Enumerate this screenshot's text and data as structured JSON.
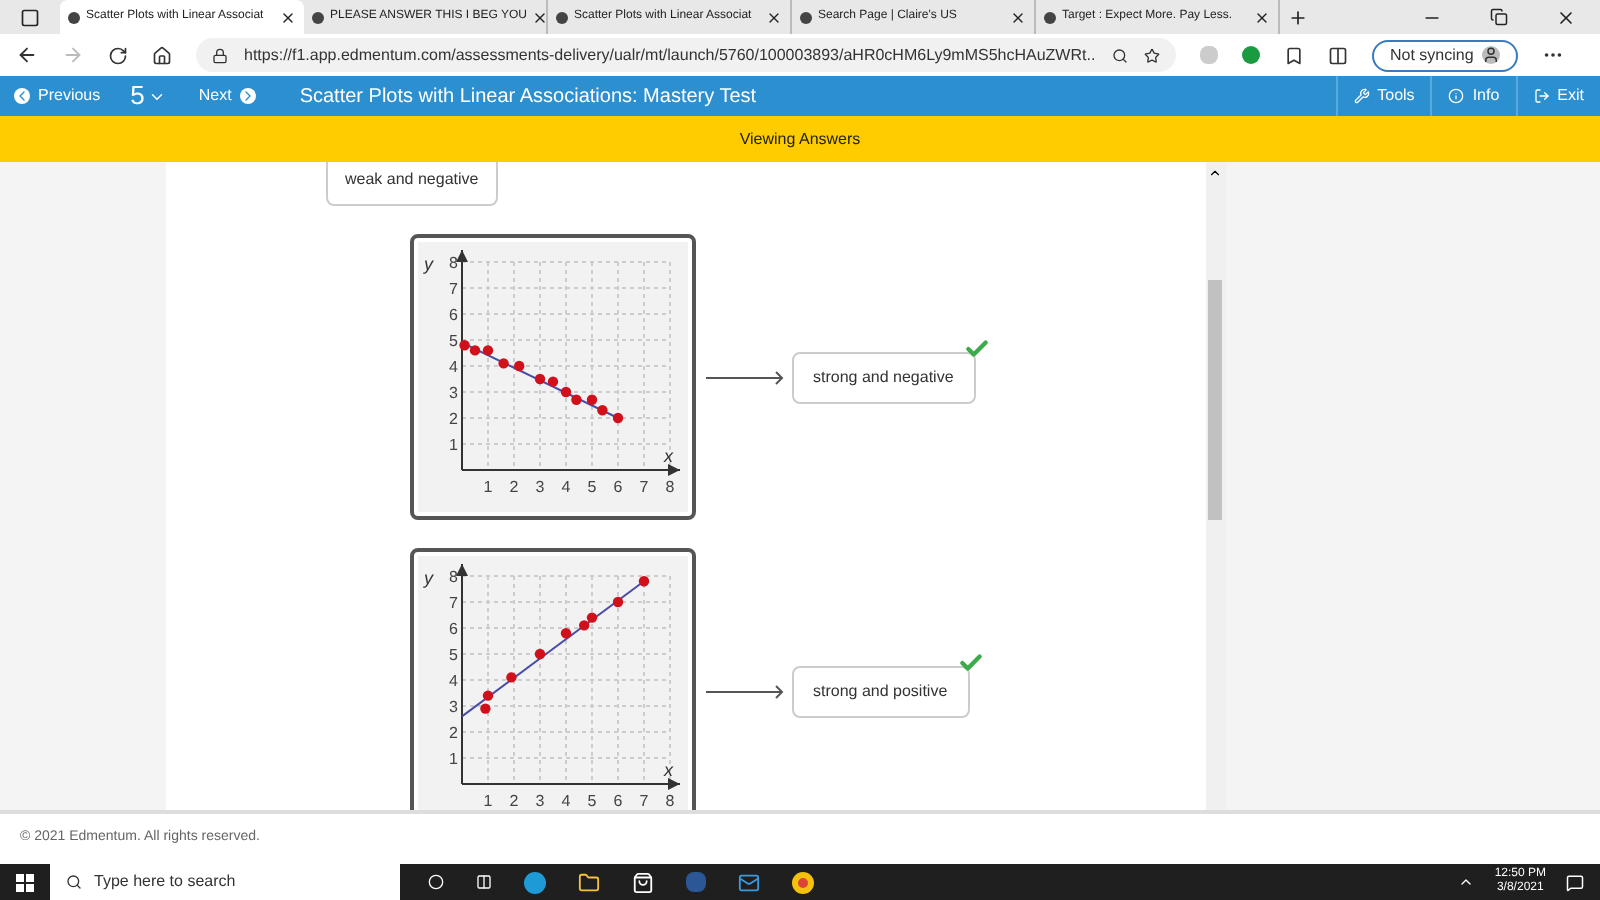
{
  "browser_tabs": [
    {
      "title": "Scatter Plots with Linear Associat",
      "selected": true
    },
    {
      "title": "PLEASE ANSWER THIS I BEG YOU",
      "selected": false
    },
    {
      "title": "Scatter Plots with Linear Associat",
      "selected": false
    },
    {
      "title": "Search Page | Claire's US",
      "selected": false
    },
    {
      "title": "Target : Expect More. Pay Less.",
      "selected": false
    }
  ],
  "address": "https://f1.app.edmentum.com/assessments-delivery/ualr/mt/launch/5760/100003893/aHR0cHM6Ly9mMS5hcHAuZWRt...",
  "sync_button": "Not syncing",
  "toolbar": {
    "previous": "Previous",
    "question_number": "5",
    "next": "Next",
    "title": "Scatter Plots with Linear Associations: Mastery Test",
    "tools": "Tools",
    "info": "Info",
    "exit": "Exit"
  },
  "banner": "Viewing Answers",
  "unused_answer": "weak and negative",
  "matches": [
    {
      "answer": "strong and negative",
      "correct": true,
      "chart_data": {
        "type": "scatter",
        "xlabel": "x",
        "ylabel": "y",
        "xlim": [
          0,
          8
        ],
        "ylim": [
          0,
          8
        ],
        "xticks": [
          1,
          2,
          3,
          4,
          5,
          6,
          7,
          8
        ],
        "yticks": [
          1,
          2,
          3,
          4,
          5,
          6,
          7,
          8
        ],
        "grid": true,
        "series": [
          {
            "type": "scatter",
            "x": [
              0.1,
              0.5,
              1,
              1.6,
              2.2,
              3,
              3.5,
              4,
              4.4,
              5,
              5.4,
              6
            ],
            "values": [
              4.8,
              4.6,
              4.6,
              4.1,
              4,
              3.5,
              3.4,
              3,
              2.7,
              2.7,
              2.3,
              2
            ]
          },
          {
            "type": "line",
            "x": [
              0,
              6
            ],
            "values": [
              4.9,
              2
            ]
          }
        ]
      }
    },
    {
      "answer": "strong and positive",
      "correct": true,
      "chart_data": {
        "type": "scatter",
        "xlabel": "x",
        "ylabel": "y",
        "xlim": [
          0,
          8
        ],
        "ylim": [
          0,
          8
        ],
        "xticks": [
          1,
          2,
          3,
          4,
          5,
          6,
          7,
          8
        ],
        "yticks": [
          1,
          2,
          3,
          4,
          5,
          6,
          7,
          8
        ],
        "grid": true,
        "series": [
          {
            "type": "scatter",
            "x": [
              0.9,
              1,
              1.9,
              3,
              4,
              4.7,
              5,
              6,
              7
            ],
            "values": [
              2.9,
              3.4,
              4.1,
              5,
              5.8,
              6.1,
              6.4,
              7,
              7.8
            ]
          },
          {
            "type": "line",
            "x": [
              0,
              7
            ],
            "values": [
              2.6,
              7.8
            ]
          }
        ]
      }
    }
  ],
  "footer": "© 2021 Edmentum. All rights reserved.",
  "taskbar": {
    "search_placeholder": "Type here to search",
    "time": "12:50 PM",
    "date": "3/8/2021"
  }
}
